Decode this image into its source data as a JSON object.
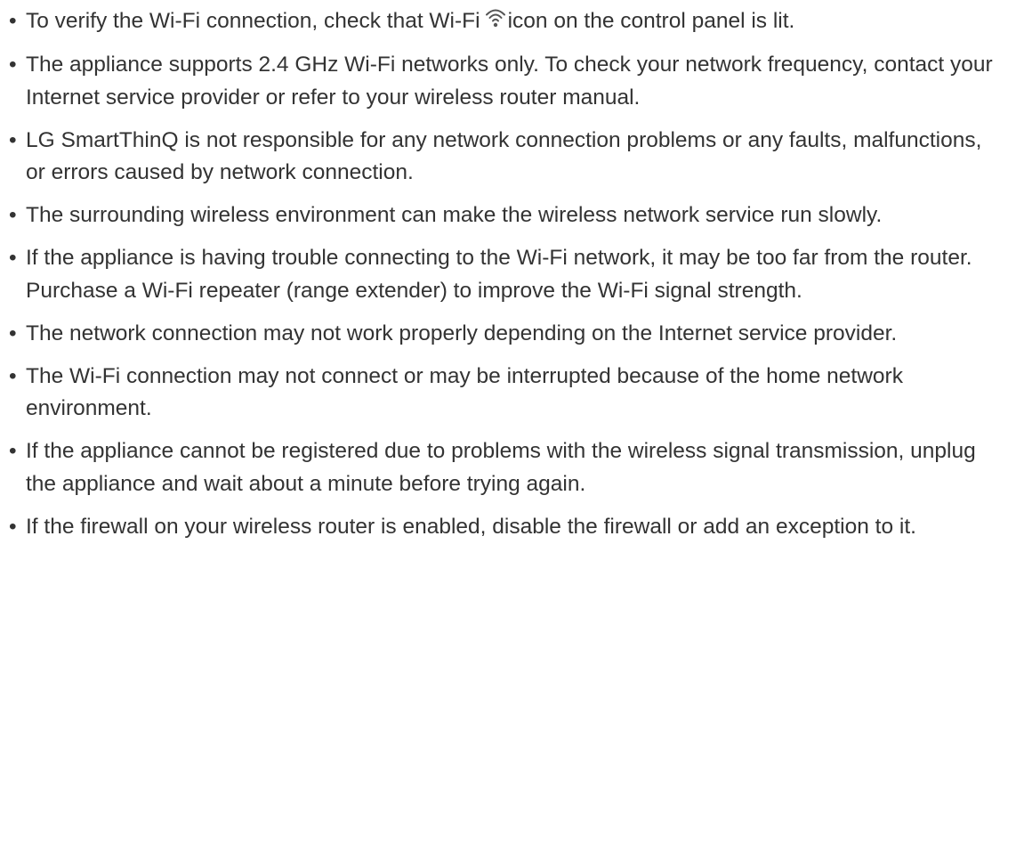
{
  "bullet_glyph": "•",
  "icons": {
    "wifi": "wifi-icon"
  },
  "notes": [
    {
      "before_icon": "To verify the Wi-Fi connection, check that Wi-Fi",
      "after_icon": "icon on the control panel is lit."
    },
    {
      "text": "The appliance supports 2.4 GHz Wi-Fi networks only. To check your network frequency, contact your Internet service provider or refer to your wireless router manual."
    },
    {
      "text": "LG SmartThinQ is not responsible for any network connection problems or any faults, malfunctions, or errors caused by network connection."
    },
    {
      "text": "The surrounding wireless environment can make the wireless network service run slowly."
    },
    {
      "text": "If the appliance is having trouble connecting to the Wi-Fi network, it may be too far from the router. Purchase a Wi-Fi repeater (range extender) to improve the Wi-Fi signal strength."
    },
    {
      "text": "The network connection may not work properly depending on the Internet service provider."
    },
    {
      "text": "The Wi-Fi connection may not connect or may be interrupted because of the home network environment."
    },
    {
      "text": "If the appliance cannot be registered due to problems with the wireless signal transmission, unplug the appliance and wait about a minute before trying again."
    },
    {
      "text": "If the firewall on your wireless router is enabled, disable the firewall or add an exception to it."
    }
  ]
}
